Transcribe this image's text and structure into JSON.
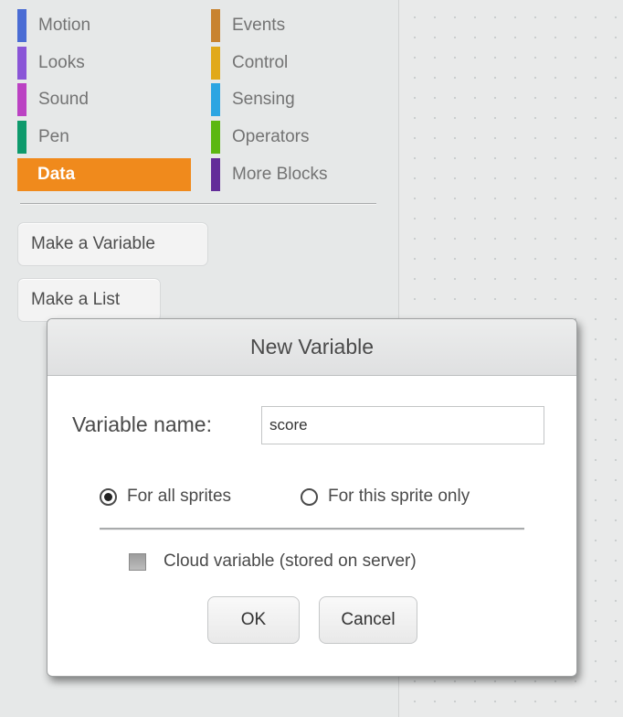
{
  "palette": {
    "categories_left": [
      {
        "label": "Motion",
        "color": "#4a6cd4"
      },
      {
        "label": "Looks",
        "color": "#8a55d7"
      },
      {
        "label": "Sound",
        "color": "#bb42c3"
      },
      {
        "label": "Pen",
        "color": "#0e9a6c"
      },
      {
        "label": "Data",
        "color": "#ee7d16",
        "selected": true
      }
    ],
    "categories_right": [
      {
        "label": "Events",
        "color": "#c88330"
      },
      {
        "label": "Control",
        "color": "#e1a91a"
      },
      {
        "label": "Sensing",
        "color": "#2ca5e2"
      },
      {
        "label": "Operators",
        "color": "#5cb712"
      },
      {
        "label": "More Blocks",
        "color": "#632d99"
      }
    ],
    "make_variable": "Make a Variable",
    "make_list": "Make a List"
  },
  "dialog": {
    "title": "New Variable",
    "name_label": "Variable name:",
    "name_value": "score",
    "radio_all": "For all sprites",
    "radio_all_checked": true,
    "radio_this": "For this sprite only",
    "radio_this_checked": false,
    "cloud_label": "Cloud variable (stored on server)",
    "cloud_checked": false,
    "ok": "OK",
    "cancel": "Cancel"
  }
}
